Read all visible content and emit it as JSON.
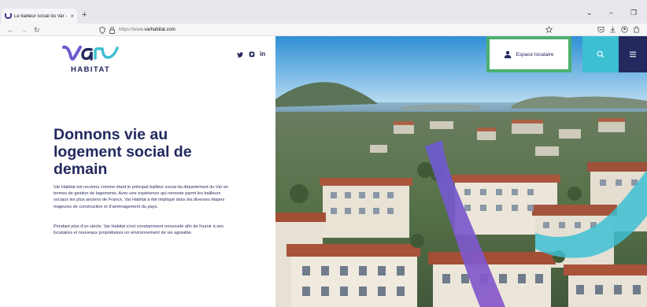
{
  "browser": {
    "tab_title": "Le bailleur social du Var - Var H",
    "tab_close": "×",
    "new_tab": "+",
    "url_prefix": "https://www.",
    "url_domain": "varhabitat.com",
    "controls": {
      "list": "⌄",
      "minimize": "–",
      "restore": "❐"
    },
    "nav": {
      "back": "←",
      "forward": "→",
      "reload": "↻"
    }
  },
  "header": {
    "logo_text": "HABITAT",
    "social": [
      "twitter-icon",
      "instagram-icon",
      "linkedin-icon"
    ],
    "account_label": "Espace locataire",
    "colors": {
      "navy": "#23285e",
      "cyan": "#3dbfd2",
      "green_highlight": "#4caf6f",
      "violet": "#6a5bd0"
    }
  },
  "hero": {
    "title_lines": [
      "Donnons vie au",
      "logement social de",
      "demain"
    ],
    "paragraph_1": "Var Habitat est reconnu comme étant le principal bailleur social du département du Var en termes de gestion de logements. Avec une expérience qui remonte parmi les bailleurs sociaux les plus anciens de France, Var Habitat a été impliqué dans les diverses étapes majeures de construction et d'aménagement du pays.",
    "paragraph_2": "Pendant plus d'un siècle, Var Habitat s'est constamment renouvelé afin de fournir à ses locataires et nouveaux propriétaires un environnement de vie agréable."
  }
}
